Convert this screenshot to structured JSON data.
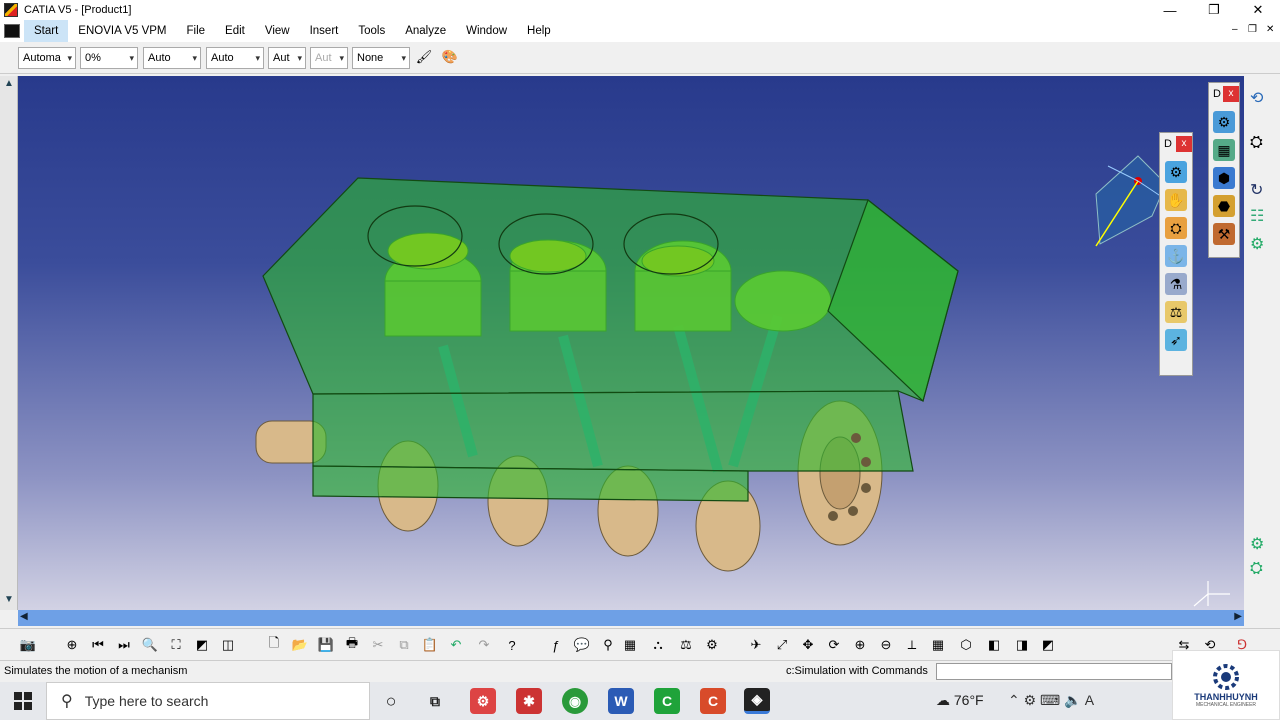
{
  "window": {
    "title": "CATIA V5 - [Product1]",
    "controls": {
      "minimize": "—",
      "maximize": "❐",
      "close": "✕"
    }
  },
  "menubar": {
    "items": [
      "Start",
      "ENOVIA V5 VPM",
      "File",
      "Edit",
      "View",
      "Insert",
      "Tools",
      "Analyze",
      "Window",
      "Help"
    ]
  },
  "toolbar": {
    "combos": [
      "Automa",
      "0%",
      "Auto",
      "Auto",
      "Aut",
      "Aut",
      "None"
    ]
  },
  "floating_toolbars": [
    {
      "title": "D",
      "close": "x"
    },
    {
      "title": "D",
      "close": "x"
    }
  ],
  "status": {
    "message": "Simulates the motion of a mechanism",
    "command_label": "c:Simulation with Commands",
    "command_value": ""
  },
  "taskbar": {
    "search_placeholder": "Type here to search",
    "weather": "76°F"
  },
  "brand": {
    "name": "THANHHUYNH",
    "tagline": "MECHANICAL ENGINEER"
  },
  "colors": {
    "viewport_top": "#283a8c",
    "viewport_bottom": "#d2d2e4",
    "engine_block": "#2fb82f",
    "piston": "#a0e83a",
    "crankshaft": "#d8b98a",
    "rod": "#2aa8c8"
  }
}
